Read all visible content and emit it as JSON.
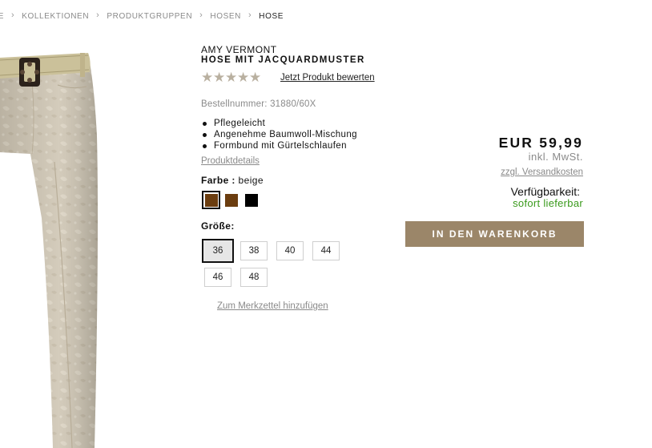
{
  "breadcrumb": [
    {
      "label": "TE"
    },
    {
      "label": "KOLLEKTIONEN"
    },
    {
      "label": "PRODUKTGRUPPEN"
    },
    {
      "label": "HOSEN"
    },
    {
      "label": "HOSE"
    }
  ],
  "product": {
    "brand": "AMY VERMONT",
    "name": "HOSE MIT JACQUARDMUSTER",
    "rating": {
      "stars": 5,
      "filled": 0,
      "link_label": "Jetzt Produkt bewerten"
    },
    "order_number": "Bestellnummer: 31880/60X",
    "features": [
      "Pflegeleicht",
      "Angenehme Baumwoll-Mischung",
      "Formbund mit Gürtelschlaufen"
    ],
    "details_link": "Produktdetails"
  },
  "color": {
    "label": "Farbe :",
    "selected": "beige",
    "swatches": [
      {
        "hex": "#6b3d0f",
        "selected": true
      },
      {
        "hex": "#6b3d0f",
        "selected": false
      },
      {
        "hex": "#000000",
        "selected": false
      }
    ]
  },
  "size": {
    "label": "Größe:",
    "options": [
      "36",
      "38",
      "40",
      "44",
      "46",
      "48"
    ],
    "selected": "36"
  },
  "wishlist_link": "Zum Merkzettel hinzufügen",
  "price": {
    "amount": "EUR 59,99",
    "tax_note": "inkl. MwSt.",
    "shipping_link": "zzgl. Versandkosten",
    "availability_label": "Verfügbarkeit:",
    "availability_value": "sofort lieferbar"
  },
  "cart_button": "IN DEN WARENKORB",
  "colors": {
    "accent": "#9b8669",
    "available": "#3a9a1c",
    "muted_text": "#8a8a8a",
    "star": "#b9b0a0"
  },
  "icons": {
    "breadcrumb_separator": "chevron-right-icon",
    "rating": "star-icon"
  }
}
